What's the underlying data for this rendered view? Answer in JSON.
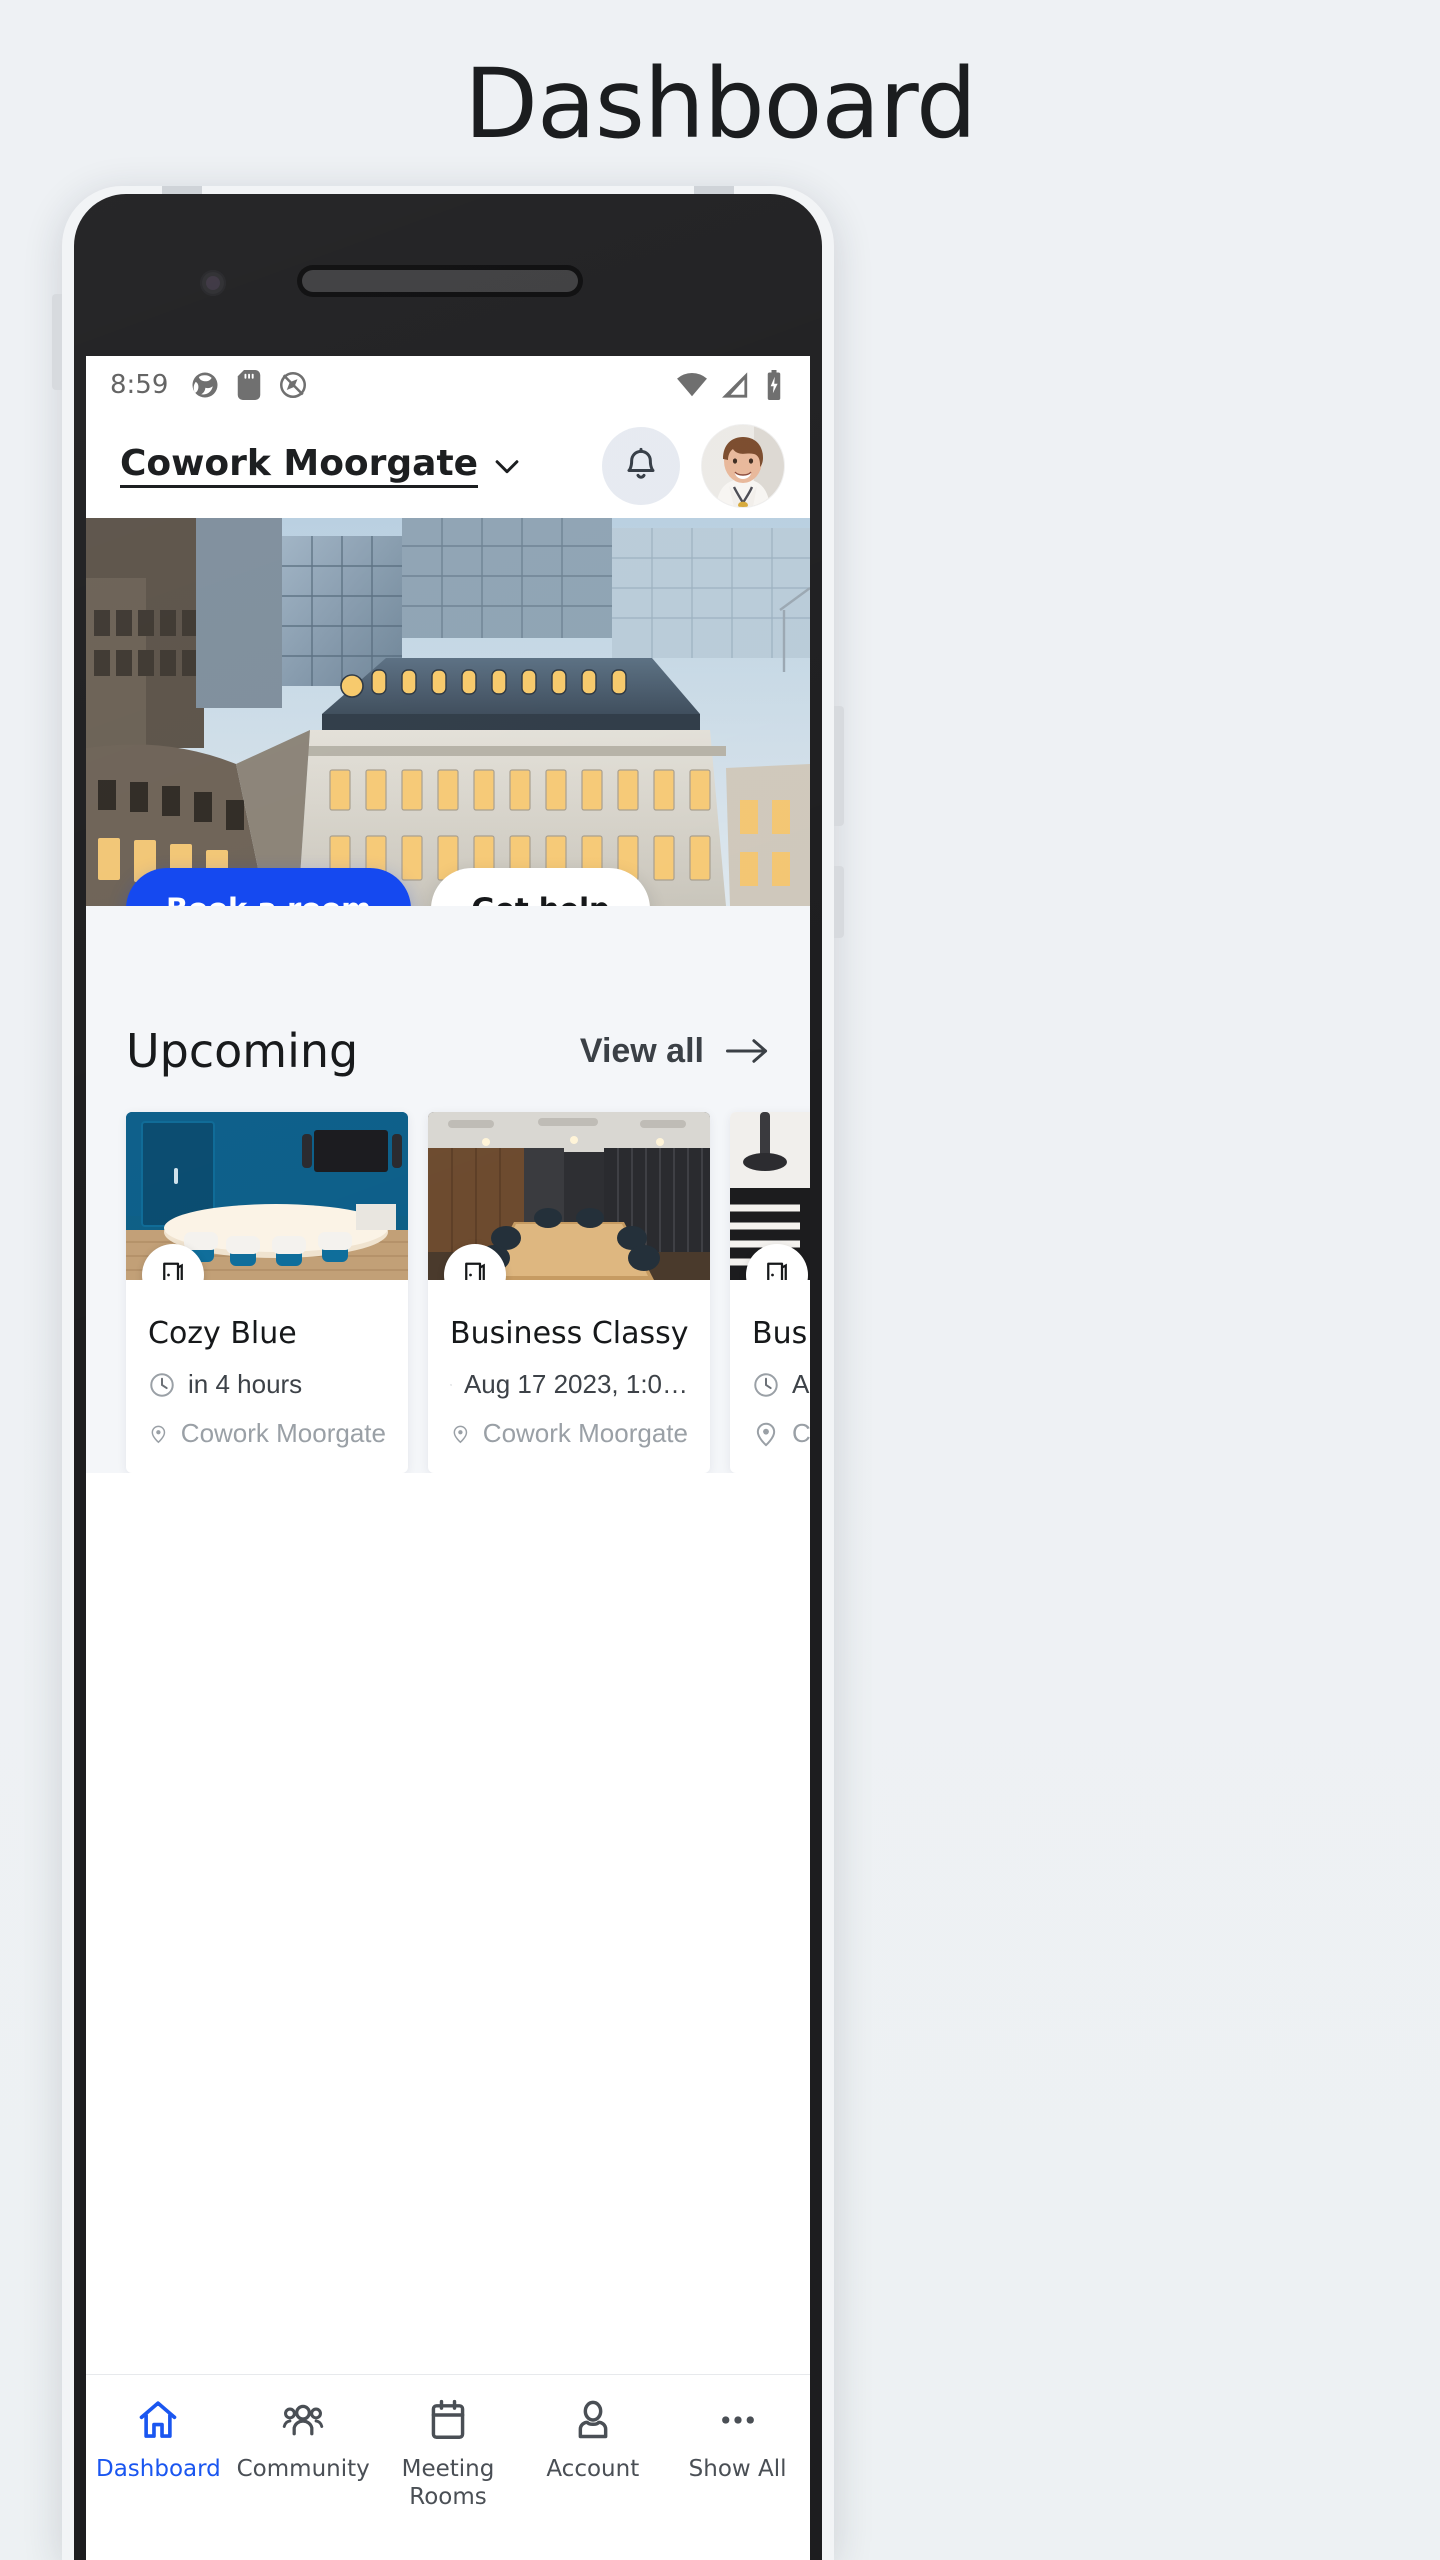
{
  "page": {
    "title": "Dashboard"
  },
  "statusbar": {
    "time": "8:59",
    "left_icons": [
      "sync-icon",
      "sd-card-icon",
      "location-off-icon"
    ],
    "right_icons": [
      "wifi-icon",
      "cell-signal-icon",
      "battery-charging-icon"
    ]
  },
  "header": {
    "location_name": "Cowork Moorgate",
    "chevron_icon": "chevron-down-icon",
    "bell_icon": "bell-icon",
    "avatar_icon": "user-avatar"
  },
  "hero": {
    "image_alt": "office-building-exterior",
    "primary_button": "Book a room",
    "secondary_button": "Get help"
  },
  "upcoming": {
    "title": "Upcoming",
    "view_all_label": "View all",
    "view_all_icon": "arrow-right-icon",
    "cards": [
      {
        "title": "Cozy Blue",
        "time": "in 4 hours",
        "location": "Cowork Moorgate",
        "time_icon": "clock-icon",
        "location_icon": "map-pin-icon",
        "badge_icon": "door-icon",
        "image_alt": "blue-meeting-room"
      },
      {
        "title": "Business Classy",
        "time": "Aug 17 2023, 1:0…",
        "location": "Cowork Moorgate",
        "time_icon": "clock-icon",
        "location_icon": "map-pin-icon",
        "badge_icon": "door-icon",
        "image_alt": "dark-wood-boardroom"
      },
      {
        "title": "Bus",
        "time": "A",
        "location": "C",
        "time_icon": "clock-icon",
        "location_icon": "map-pin-icon",
        "badge_icon": "door-icon",
        "image_alt": "white-striped-room"
      }
    ]
  },
  "bottom_nav": {
    "items": [
      {
        "label": "Dashboard",
        "icon": "home-icon",
        "active": true
      },
      {
        "label": "Community",
        "icon": "people-icon",
        "active": false
      },
      {
        "label": "Meeting Rooms",
        "icon": "calendar-icon",
        "active": false
      },
      {
        "label": "Account",
        "icon": "person-icon",
        "active": false
      },
      {
        "label": "Show All",
        "icon": "ellipsis-icon",
        "active": false
      }
    ]
  },
  "colors": {
    "accent": "#1549f0",
    "nav_active": "#1a56f0",
    "page_bg": "#eef1f4",
    "app_bg": "#f4f6f9",
    "text": "#16181a",
    "muted": "#9aa0a6"
  }
}
